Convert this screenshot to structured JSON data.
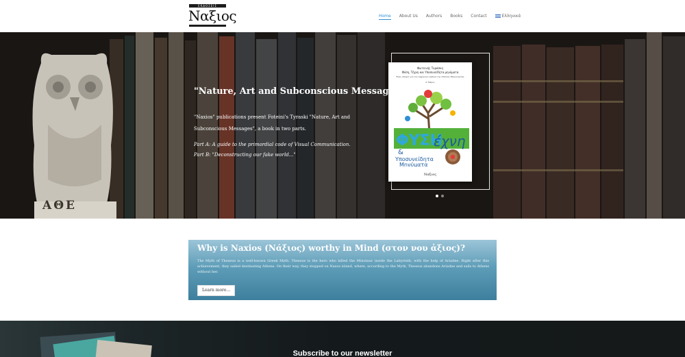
{
  "header": {
    "logo": {
      "top_text": "ΕΚΔΟΣΕΙΣ",
      "word": "Ναξιος"
    },
    "nav": [
      {
        "label": "Home",
        "active": true
      },
      {
        "label": "About Us"
      },
      {
        "label": "Authors"
      },
      {
        "label": "Books"
      },
      {
        "label": "Contact"
      },
      {
        "label": "Ελληνικά",
        "icon": "greek-flag-icon"
      }
    ]
  },
  "hero": {
    "title": "\"Nature, Art and Subconscious Messages\"",
    "text": "\"Naxios\" publications present Foteini's Tyraski \"Nature, Art and Subconscious Messages\", a book in two parts.",
    "part_a": "Part A: A guide to the primordial code of Visual Communication.",
    "part_b": "Part B: \"Deconstructing our fake world...\"",
    "owl_inscription": "ΑΘΕ",
    "book": {
      "author": "Φωτεινής Τυράσκη",
      "title": "Φύση, Τέχνη και Υποσυνείδητα μηνύματα",
      "subtitle": "Ένας οδηγός για τον αρχέγονο κώδικα της Οπτικής Επικοινωνίας",
      "part": "Α' Μέρος",
      "art_word1": "ΦΥΣΗ",
      "art_word2": "έχνη",
      "art_amp": "&",
      "art_word3": "Υποσυνείδητα",
      "art_word4": "Μηνύματα",
      "publisher": "Ναξιος"
    },
    "slider": {
      "count": 2,
      "active": 0
    }
  },
  "why": {
    "title": "Why is Naxios (Νάξιος) worthy in Mind (στον νου ἀξιος)?",
    "text": "The Myth of Theseus is a well-known Greek Myth. Theseus is the hero who killed the Minotaur inside the Labyrinth, with the help of Ariadne. Right after this achievement, they sailed destinating Athens. On their way, they stopped on Naxos island, where, according to the Myth, Theseus abandons Ariadne and sails to Athens without her.",
    "button": "Learn more..."
  },
  "newsletter": {
    "title": "Subscribe to our newsletter"
  },
  "colors": {
    "accent": "#2e8fd6",
    "why_bg": "#5e9db8"
  }
}
